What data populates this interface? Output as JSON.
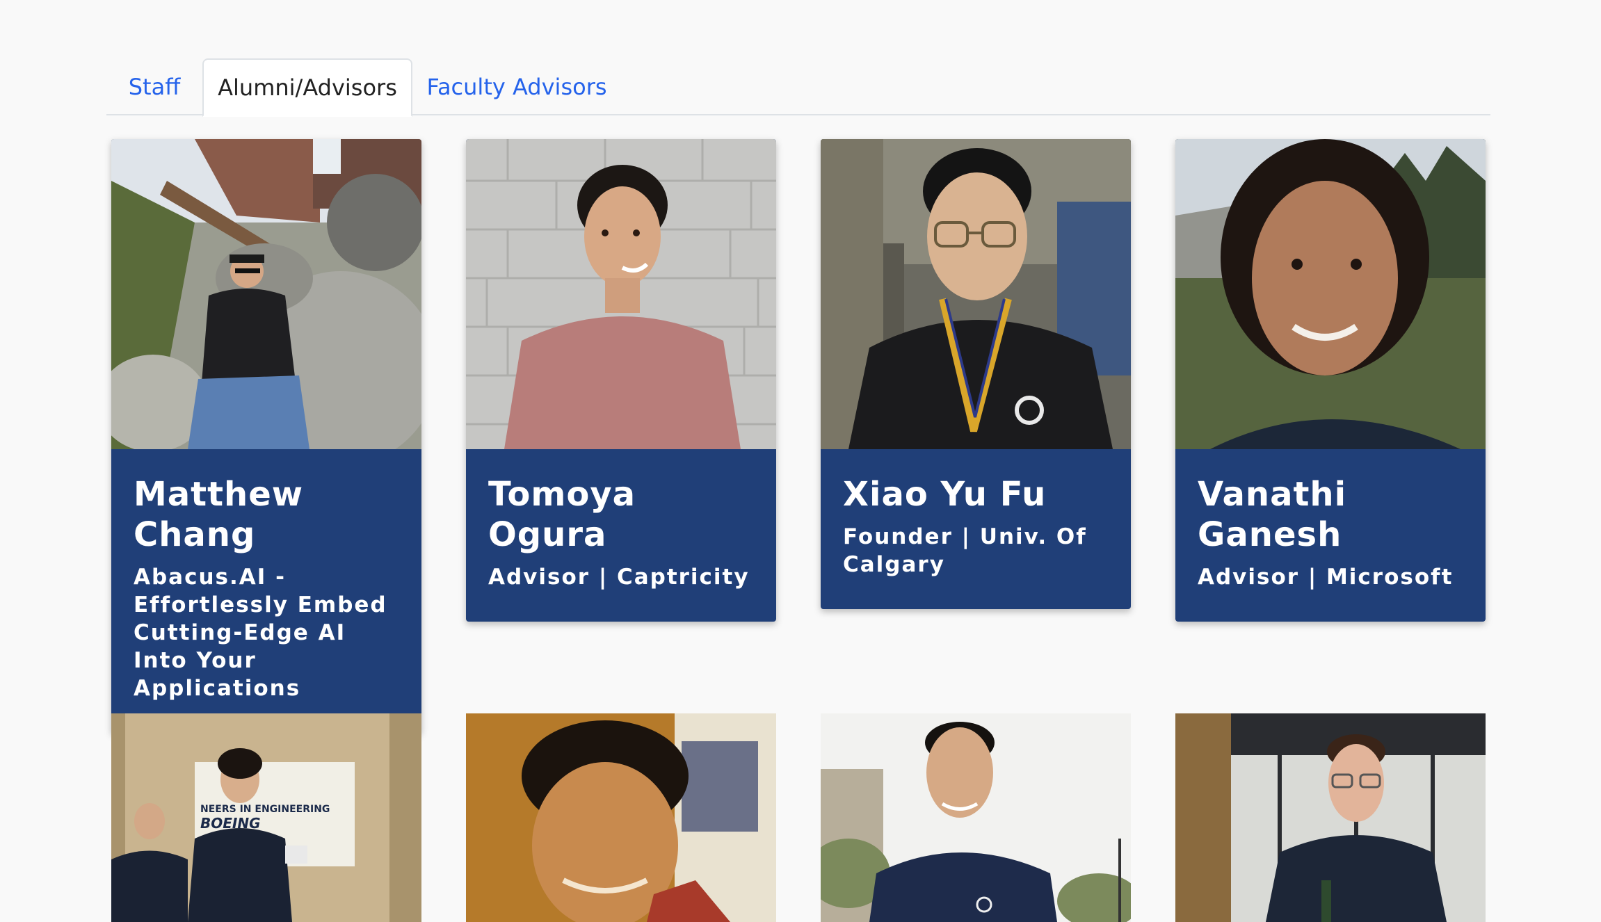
{
  "tabs": [
    {
      "label": "Staff",
      "active": false
    },
    {
      "label": "Alumni/Advisors",
      "active": true
    },
    {
      "label": "Faculty Advisors",
      "active": false
    }
  ],
  "cards": [
    {
      "name": "Matthew Chang",
      "role": "Abacus.AI - Effortlessly Embed Cutting-Edge AI Into Your Applications"
    },
    {
      "name": "Tomoya Ogura",
      "role": "Advisor | Captricity"
    },
    {
      "name": "Xiao Yu Fu",
      "role": "Founder | Univ. Of Calgary"
    },
    {
      "name": "Vanathi Ganesh",
      "role": "Advisor | Microsoft"
    }
  ],
  "colors": {
    "card_bg": "#203f78",
    "tab_link": "#2563eb",
    "page_bg": "#f9f9f9"
  },
  "photo_banner_text": "NEERS IN ENGINEERING",
  "photo_banner_logo": "BOEING"
}
